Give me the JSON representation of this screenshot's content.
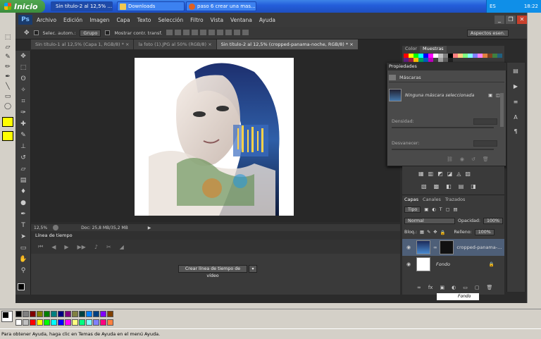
{
  "taskbar": {
    "start_label": "Inicio",
    "tasks": [
      {
        "label": "Sin título-2 al 12,5% ...",
        "active": true
      },
      {
        "label": "Downloads",
        "active": false
      },
      {
        "label": "paso 6 crear una mas...",
        "active": false
      }
    ],
    "tray": {
      "lang": "ES",
      "time": "18:22"
    }
  },
  "photoshop": {
    "logo": "Ps",
    "menu": [
      "Archivo",
      "Edición",
      "Imagen",
      "Capa",
      "Texto",
      "Selección",
      "Filtro",
      "Vista",
      "Ventana",
      "Ayuda"
    ],
    "options": {
      "auto_select_label": "Selec. autom.:",
      "group_value": "Grupo",
      "show_transform_label": "Mostrar contr. transf.",
      "workspace": "Aspectos esen."
    },
    "tabs": [
      {
        "label": "Sin título-1 al 12,5% (Capa 1, RGB/8) *",
        "active": false
      },
      {
        "label": "la foto (1).JPG al 50% (RGB/8)",
        "active": false
      },
      {
        "label": "Sin título-2 al 12,5% (cropped-panama-noche, RGB/8) *",
        "active": true
      }
    ],
    "status": {
      "zoom": "12,5%",
      "doc": "Doc: 25,8 MB/35,2 MB"
    },
    "timeline": {
      "title": "Línea de tiempo",
      "create_button": "Crear línea de tiempo de vídeo"
    },
    "swatch_tabs": [
      "Color",
      "Muestras"
    ],
    "properties": {
      "title": "Propiedades",
      "section": "Máscaras",
      "no_mask": "Ninguna máscara seleccionada",
      "density_label": "Densidad:",
      "feather_label": "Desvanecer:"
    },
    "layers": {
      "tabs": [
        "Capas",
        "Canales",
        "Trazados"
      ],
      "filter": "Tipo",
      "blend_mode": "Normal",
      "opacity_label": "Opacidad:",
      "opacity_value": "100%",
      "lock_label": "Bloq.:",
      "fill_label": "Relleno:",
      "fill_value": "100%",
      "items": [
        {
          "name": "cropped-panama-...",
          "selected": true
        },
        {
          "name": "Fondo",
          "selected": false
        }
      ],
      "behind_layer": "Fondo"
    }
  },
  "help_bar": "Para obtener Ayuda, haga clic en Temas de Ayuda en el menú Ayuda.",
  "palette_colors": [
    "#000000",
    "#808080",
    "#800000",
    "#808000",
    "#008000",
    "#008080",
    "#000080",
    "#800080",
    "#808040",
    "#004040",
    "#0080ff",
    "#004080",
    "#8000ff",
    "#804000",
    "#ffffff",
    "#c0c0c0",
    "#ff0000",
    "#ffff00",
    "#00ff00",
    "#00ffff",
    "#0000ff",
    "#ff00ff",
    "#ffff80",
    "#00ff80",
    "#80ffff",
    "#8080ff",
    "#ff0080",
    "#ff8040"
  ],
  "swatch_colors": [
    "#ff0000",
    "#ffff00",
    "#00ff00",
    "#00ffff",
    "#0000ff",
    "#ff00ff",
    "#ffffff",
    "#c0c0c0",
    "#808080",
    "#000000",
    "#ff8080",
    "#ffd080",
    "#80ff80",
    "#80ffff",
    "#8080ff",
    "#ff80ff",
    "#e08040",
    "#804020",
    "#408040",
    "#206080",
    "#602080",
    "#a02040",
    "#ffc000",
    "#00a060",
    "#0060c0",
    "#c000c0",
    "#404040",
    "#a0a0a0",
    "#606060",
    "#202020"
  ]
}
